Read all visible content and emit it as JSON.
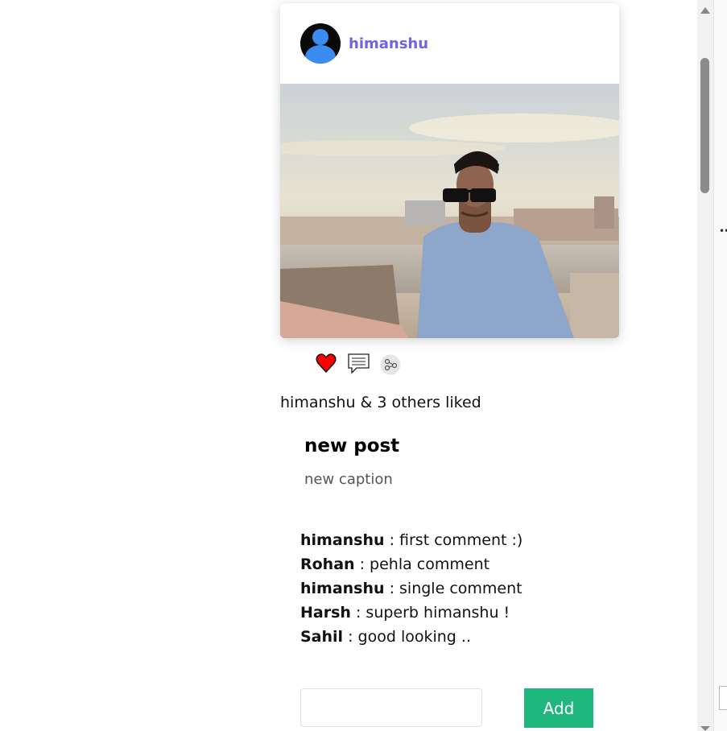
{
  "post": {
    "author": "himanshu",
    "likes_text": "himanshu & 3 others liked",
    "title": "new post",
    "caption": "new caption"
  },
  "actions": {
    "like_icon": "heart-icon",
    "comment_icon": "comment-icon",
    "share_icon": "share-icon",
    "like_color": "#ff0000"
  },
  "comments": [
    {
      "user": "himanshu",
      "text": " : first comment :)"
    },
    {
      "user": "Rohan",
      "text": " : pehla comment"
    },
    {
      "user": "himanshu",
      "text": " : single comment"
    },
    {
      "user": "Harsh",
      "text": " : superb himanshu !"
    },
    {
      "user": "Sahil",
      "text": " : good looking .."
    }
  ],
  "comment_form": {
    "input_value": "",
    "add_label": "Add"
  },
  "colors": {
    "username": "#6f63e0",
    "add_button": "#1fb77b"
  }
}
